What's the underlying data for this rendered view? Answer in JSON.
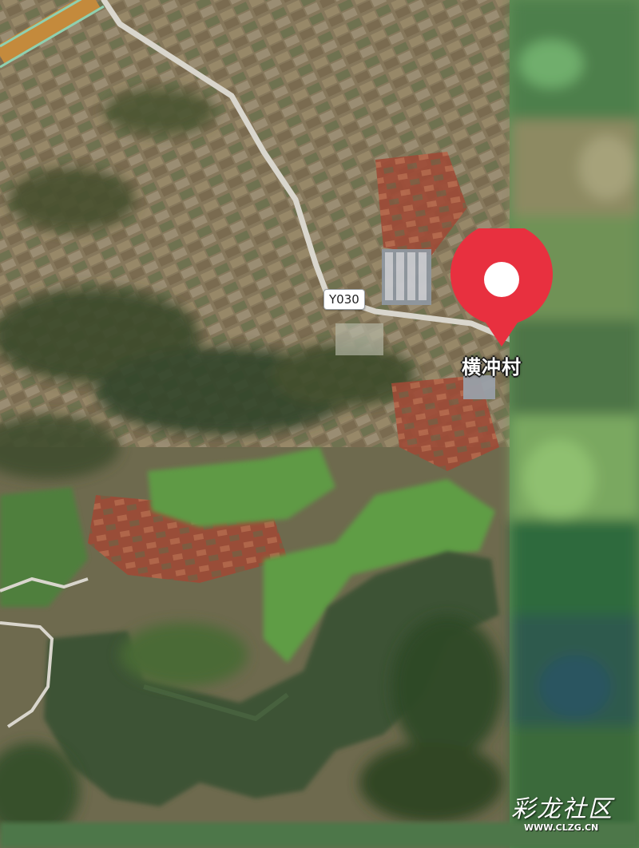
{
  "map": {
    "view": "satellite",
    "road_label": "Y030",
    "place_label": "横冲村",
    "marker_icon": "location-pin-icon",
    "marker_color": "#e8303f"
  },
  "watermark": {
    "title": "彩龙社区",
    "site": "WWW.CLZG.CN"
  }
}
